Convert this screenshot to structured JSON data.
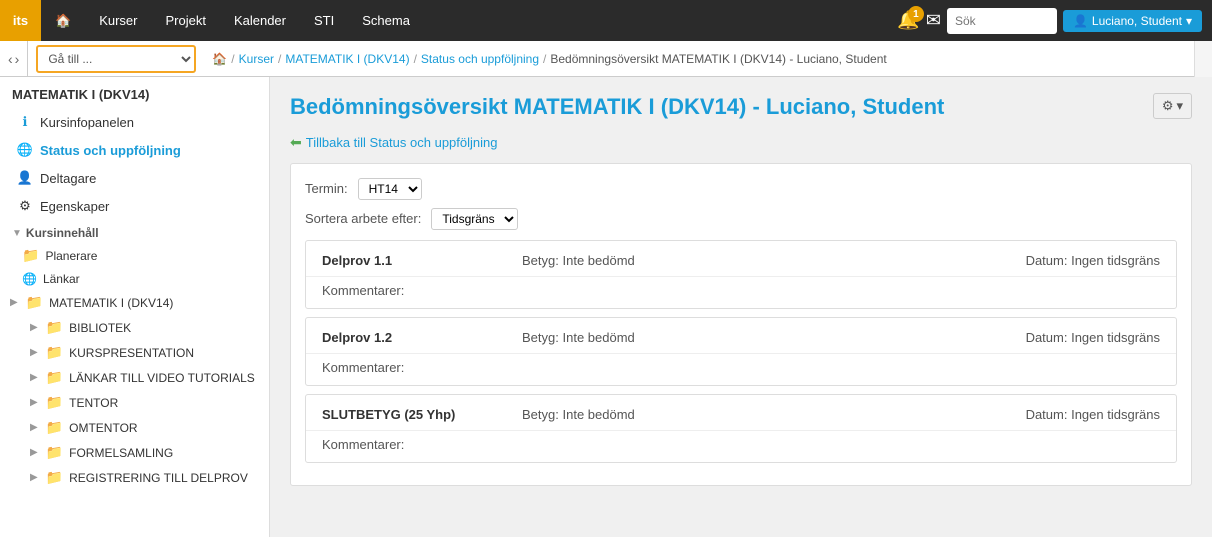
{
  "logo": {
    "text": "its"
  },
  "topnav": {
    "links": [
      {
        "label": "Kurser",
        "active": false
      },
      {
        "label": "Projekt",
        "active": false
      },
      {
        "label": "Kalender",
        "active": false
      },
      {
        "label": "STI",
        "active": false
      },
      {
        "label": "Schema",
        "active": false
      }
    ],
    "notification_count": "1",
    "search_placeholder": "Sök",
    "user_label": "Luciano, Student"
  },
  "subnav": {
    "goto_default": "Gå till ...",
    "home_icon": "🏠",
    "breadcrumb": [
      {
        "label": "Kurser",
        "link": true
      },
      {
        "label": "MATEMATIK I (DKV14)",
        "link": true
      },
      {
        "label": "Status och uppföljning",
        "link": true
      },
      {
        "label": "Bedömningsöversikt MATEMATIK I (DKV14) - Luciano, Student",
        "link": false
      }
    ]
  },
  "sidebar": {
    "course_title": "MATEMATIK I (DKV14)",
    "items": [
      {
        "label": "Kursinfopanelen",
        "icon": "info",
        "active": false
      },
      {
        "label": "Status och uppföljning",
        "icon": "globe",
        "active": true
      },
      {
        "label": "Deltagare",
        "icon": "person",
        "active": false
      },
      {
        "label": "Egenskaper",
        "icon": "gear",
        "active": false
      }
    ],
    "section_header": "Kursinnehåll",
    "folders_top": [
      {
        "label": "Planerare",
        "icon": "folder",
        "expandable": false
      },
      {
        "label": "Länkar",
        "icon": "globe",
        "expandable": false
      }
    ],
    "course_folder": "MATEMATIK I (DKV14)",
    "subfolders": [
      {
        "label": "BIBLIOTEK"
      },
      {
        "label": "KURSPRESENTATION"
      },
      {
        "label": "LÄNKAR TILL VIDEO TUTORIALS"
      },
      {
        "label": "TENTOR"
      },
      {
        "label": "OMTENTOR"
      },
      {
        "label": "FORMELSAMLING"
      },
      {
        "label": "REGISTRERING TILL DELPROV"
      }
    ]
  },
  "main": {
    "page_title": "Bedömningsöversikt MATEMATIK I (DKV14) - Luciano, Student",
    "back_link": "Tillbaka till Status och uppföljning",
    "gear_label": "⚙",
    "term_label": "Termin:",
    "term_value": "HT14",
    "sort_label": "Sortera arbete efter:",
    "sort_value": "Tidsgräns",
    "assessments": [
      {
        "name": "Delprov 1.1",
        "grade_label": "Betyg:",
        "grade_value": "Inte bedömd",
        "date_label": "Datum:",
        "date_value": "Ingen tidsgräns",
        "comments_label": "Kommentarer:"
      },
      {
        "name": "Delprov 1.2",
        "grade_label": "Betyg:",
        "grade_value": "Inte bedömd",
        "date_label": "Datum:",
        "date_value": "Ingen tidsgräns",
        "comments_label": "Kommentarer:"
      },
      {
        "name": "SLUTBETYG (25 Yhp)",
        "grade_label": "Betyg:",
        "grade_value": "Inte bedömd",
        "date_label": "Datum:",
        "date_value": "Ingen tidsgräns",
        "comments_label": "Kommentarer:"
      }
    ]
  }
}
